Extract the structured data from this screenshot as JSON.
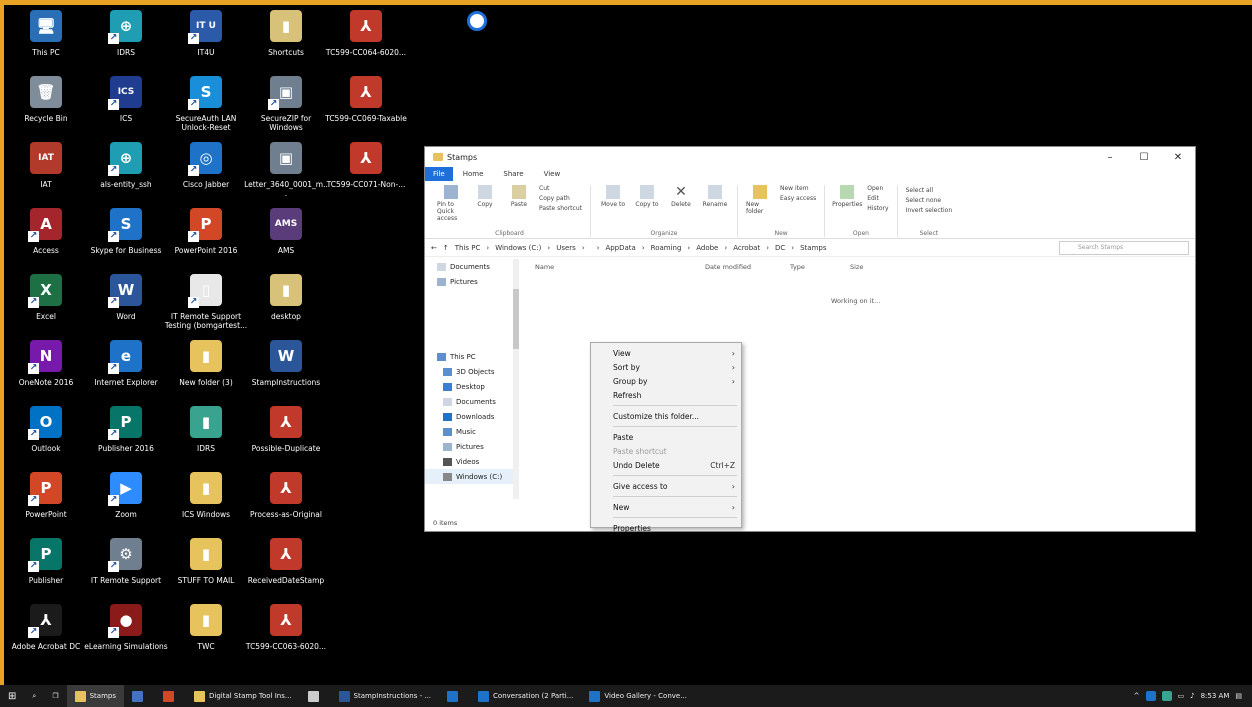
{
  "desktop_icons": [
    {
      "label": "This PC",
      "glyph": "🖥",
      "bg": "#2a6fb6",
      "col": 0,
      "row": 0,
      "shortcut": false
    },
    {
      "label": "IDRS",
      "glyph": "⊕",
      "bg": "#1f9db2",
      "col": 1,
      "row": 0,
      "shortcut": true
    },
    {
      "label": "IT4U",
      "glyph": "IT U",
      "bg": "#2b5aa8",
      "col": 2,
      "row": 0,
      "shortcut": true
    },
    {
      "label": "Shortcuts",
      "glyph": "▮",
      "bg": "#d8c27a",
      "col": 3,
      "row": 0,
      "shortcut": false
    },
    {
      "label": "TC599-CC064-6020...",
      "glyph": "⅄",
      "bg": "#c0392b",
      "col": 4,
      "row": 0,
      "shortcut": false
    },
    {
      "label": "Recycle Bin",
      "glyph": "🗑",
      "bg": "#7f8c9a",
      "col": 0,
      "row": 1,
      "shortcut": false
    },
    {
      "label": "ICS",
      "glyph": "ICS",
      "bg": "#1f3c8f",
      "col": 1,
      "row": 1,
      "shortcut": true
    },
    {
      "label": "SecureAuth LAN Unlock-Reset",
      "glyph": "S",
      "bg": "#1a8fd9",
      "col": 2,
      "row": 1,
      "shortcut": true
    },
    {
      "label": "SecureZIP for Windows",
      "glyph": "▣",
      "bg": "#6f7f8f",
      "col": 3,
      "row": 1,
      "shortcut": true
    },
    {
      "label": "TC599-CC069-Taxable",
      "glyph": "⅄",
      "bg": "#c0392b",
      "col": 4,
      "row": 1,
      "shortcut": false
    },
    {
      "label": "IAT",
      "glyph": "IAT",
      "bg": "#b23a2a",
      "col": 0,
      "row": 2,
      "shortcut": false
    },
    {
      "label": "als-entity_ssh",
      "glyph": "⊕",
      "bg": "#1f9db2",
      "col": 1,
      "row": 2,
      "shortcut": true
    },
    {
      "label": "Cisco Jabber",
      "glyph": "◎",
      "bg": "#1e73c8",
      "col": 2,
      "row": 2,
      "shortcut": true
    },
    {
      "label": "Letter_3640_0001_m...",
      "glyph": "▣",
      "bg": "#6f7f8f",
      "col": 3,
      "row": 2,
      "shortcut": false
    },
    {
      "label": "TC599-CC071-Non-...",
      "glyph": "⅄",
      "bg": "#c0392b",
      "col": 4,
      "row": 2,
      "shortcut": false
    },
    {
      "label": "Access",
      "glyph": "A",
      "bg": "#a4262c",
      "col": 0,
      "row": 3,
      "shortcut": true
    },
    {
      "label": "Skype for Business",
      "glyph": "S",
      "bg": "#1e73c8",
      "col": 1,
      "row": 3,
      "shortcut": true
    },
    {
      "label": "PowerPoint 2016",
      "glyph": "P",
      "bg": "#d24726",
      "col": 2,
      "row": 3,
      "shortcut": true
    },
    {
      "label": "AMS",
      "glyph": "AMS",
      "bg": "#5a3c7a",
      "col": 3,
      "row": 3,
      "shortcut": false
    },
    {
      "label": "Excel",
      "glyph": "X",
      "bg": "#1d7044",
      "col": 0,
      "row": 4,
      "shortcut": true
    },
    {
      "label": "Word",
      "glyph": "W",
      "bg": "#2b579a",
      "col": 1,
      "row": 4,
      "shortcut": true
    },
    {
      "label": "IT Remote Support Testing (bomgartest...",
      "glyph": "▯",
      "bg": "#e8e8e8",
      "col": 2,
      "row": 4,
      "shortcut": true
    },
    {
      "label": "desktop",
      "glyph": "▮",
      "bg": "#d8c27a",
      "col": 3,
      "row": 4,
      "shortcut": false
    },
    {
      "label": "OneNote 2016",
      "glyph": "N",
      "bg": "#7719aa",
      "col": 0,
      "row": 5,
      "shortcut": true
    },
    {
      "label": "Internet Explorer",
      "glyph": "e",
      "bg": "#1e73c8",
      "col": 1,
      "row": 5,
      "shortcut": true
    },
    {
      "label": "New folder (3)",
      "glyph": "▮",
      "bg": "#e6c35c",
      "col": 2,
      "row": 5,
      "shortcut": false
    },
    {
      "label": "StampInstructions",
      "glyph": "W",
      "bg": "#2b579a",
      "col": 3,
      "row": 5,
      "shortcut": false
    },
    {
      "label": "Outlook",
      "glyph": "O",
      "bg": "#0072c6",
      "col": 0,
      "row": 6,
      "shortcut": true
    },
    {
      "label": "Publisher 2016",
      "glyph": "P",
      "bg": "#077568",
      "col": 1,
      "row": 6,
      "shortcut": true
    },
    {
      "label": "IDRS",
      "glyph": "▮",
      "bg": "#3aa38f",
      "col": 2,
      "row": 6,
      "shortcut": false
    },
    {
      "label": "Possible-Duplicate",
      "glyph": "⅄",
      "bg": "#c0392b",
      "col": 3,
      "row": 6,
      "shortcut": false
    },
    {
      "label": "PowerPoint",
      "glyph": "P",
      "bg": "#d24726",
      "col": 0,
      "row": 7,
      "shortcut": true
    },
    {
      "label": "Zoom",
      "glyph": "▶",
      "bg": "#2d8cff",
      "col": 1,
      "row": 7,
      "shortcut": true
    },
    {
      "label": "ICS Windows",
      "glyph": "▮",
      "bg": "#e6c35c",
      "col": 2,
      "row": 7,
      "shortcut": false
    },
    {
      "label": "Process-as-Original",
      "glyph": "⅄",
      "bg": "#c0392b",
      "col": 3,
      "row": 7,
      "shortcut": false
    },
    {
      "label": "Publisher",
      "glyph": "P",
      "bg": "#077568",
      "col": 0,
      "row": 8,
      "shortcut": true
    },
    {
      "label": "IT Remote Support",
      "glyph": "⚙",
      "bg": "#6f7f8f",
      "col": 1,
      "row": 8,
      "shortcut": true
    },
    {
      "label": "STUFF TO MAIL",
      "glyph": "▮",
      "bg": "#e6c35c",
      "col": 2,
      "row": 8,
      "shortcut": false
    },
    {
      "label": "ReceivedDateStamp",
      "glyph": "⅄",
      "bg": "#c0392b",
      "col": 3,
      "row": 8,
      "shortcut": false
    },
    {
      "label": "Adobe Acrobat DC",
      "glyph": "⅄",
      "bg": "#1b1b1b",
      "col": 0,
      "row": 9,
      "shortcut": true
    },
    {
      "label": "eLearning Simulations",
      "glyph": "●",
      "bg": "#8b1a1a",
      "col": 1,
      "row": 9,
      "shortcut": true
    },
    {
      "label": "TWC",
      "glyph": "▮",
      "bg": "#e6c35c",
      "col": 2,
      "row": 9,
      "shortcut": false
    },
    {
      "label": "TC599-CC063-6020...",
      "glyph": "⅄",
      "bg": "#c0392b",
      "col": 3,
      "row": 9,
      "shortcut": false
    }
  ],
  "explorer": {
    "title": "Stamps",
    "menu": [
      "File",
      "Home",
      "Share",
      "View"
    ],
    "ribbon": {
      "clipboard": {
        "name": "Clipboard",
        "pin": "Pin to Quick access",
        "copy": "Copy",
        "paste": "Paste",
        "cut": "Cut",
        "copy_path": "Copy path",
        "paste_shortcut": "Paste shortcut"
      },
      "organize": {
        "name": "Organize",
        "move_to": "Move to",
        "copy_to": "Copy to",
        "delete": "Delete",
        "rename": "Rename"
      },
      "new": {
        "name": "New",
        "new_folder": "New folder",
        "new_item": "New item",
        "easy_access": "Easy access"
      },
      "open": {
        "name": "Open",
        "properties": "Properties",
        "open": "Open",
        "edit": "Edit",
        "history": "History"
      },
      "select": {
        "name": "Select",
        "select_all": "Select all",
        "select_none": "Select none",
        "invert": "Invert selection"
      }
    },
    "breadcrumb": [
      "This PC",
      "Windows (C:)",
      "Users",
      "",
      "AppData",
      "Roaming",
      "Adobe",
      "Acrobat",
      "DC",
      "Stamps"
    ],
    "search_placeholder": "Search Stamps",
    "nav_top": [
      "Documents",
      "Pictures"
    ],
    "nav_items": [
      "This PC",
      "3D Objects",
      "Desktop",
      "Documents",
      "Downloads",
      "Music",
      "Pictures",
      "Videos",
      "Windows (C:)"
    ],
    "columns": [
      "Name",
      "Date modified",
      "Type",
      "Size"
    ],
    "working": "Working on it...",
    "status": "0 items"
  },
  "context_menu": [
    {
      "label": "View",
      "submenu": true
    },
    {
      "label": "Sort by",
      "submenu": true
    },
    {
      "label": "Group by",
      "submenu": true
    },
    {
      "label": "Refresh"
    },
    {
      "sep": true
    },
    {
      "label": "Customize this folder..."
    },
    {
      "sep": true
    },
    {
      "label": "Paste"
    },
    {
      "label": "Paste shortcut",
      "disabled": true
    },
    {
      "label": "Undo Delete",
      "accel": "Ctrl+Z"
    },
    {
      "sep": true
    },
    {
      "label": "Give access to",
      "submenu": true
    },
    {
      "sep": true
    },
    {
      "label": "New",
      "submenu": true
    },
    {
      "sep": true
    },
    {
      "label": "Properties"
    }
  ],
  "taskbar": {
    "items": [
      {
        "label": "Stamps",
        "color": "#e6c35c",
        "active": true
      },
      {
        "label": "",
        "color": "#4472c4"
      },
      {
        "label": "",
        "color": "#d24726"
      },
      {
        "label": "Digital Stamp Tool Ins...",
        "color": "#e6c35c"
      },
      {
        "label": "",
        "color": "#ccc"
      },
      {
        "label": "StampInstructions - ...",
        "color": "#2b579a"
      },
      {
        "label": "",
        "color": "#1e73c8"
      },
      {
        "label": "Conversation (2 Parti...",
        "color": "#1e73c8"
      },
      {
        "label": "Video Gallery - Conve...",
        "color": "#1e73c8"
      }
    ],
    "clock": "8:53 AM"
  }
}
